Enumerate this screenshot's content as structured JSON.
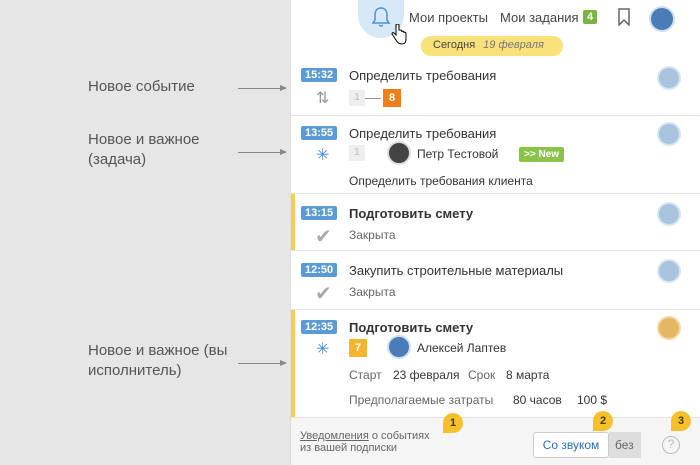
{
  "annotations": [
    {
      "text": "Новое событие"
    },
    {
      "text": "Новое и важное (задача)"
    },
    {
      "text": "Новое и важное (вы исполнитель)"
    }
  ],
  "header": {
    "my_projects": "Мои проекты",
    "my_tasks": "Мои задания",
    "tasks_count": "4",
    "today_label": "Сегодня",
    "today_date": "19 февраля"
  },
  "events": [
    {
      "time": "15:32",
      "title": "Определить требования",
      "gray_num": "1",
      "orange_num": "8",
      "icon": "swap-arrows-icon"
    },
    {
      "time": "13:55",
      "title": "Определить требования",
      "gray_num": "1",
      "person": "Петр Тестовой",
      "badge": ">> New",
      "description": "Определить требования клиента",
      "icon": "snowflake-icon"
    },
    {
      "time": "13:15",
      "title": "Подготовить смету",
      "status": "Закрыта",
      "icon": "checkmark-icon"
    },
    {
      "time": "12:50",
      "title": "Закупить строительные материалы",
      "status": "Закрыта",
      "icon": "checkmark-icon"
    },
    {
      "time": "12:35",
      "title": "Подготовить смету",
      "yellow_num": "7",
      "person": "Алексей Лаптев",
      "start_label": "Старт",
      "start_date": "23 февраля",
      "due_label": "Срок",
      "due_date": "8 марта",
      "cost_label": "Предполагаемые затраты",
      "hours": "80 часов",
      "money": "100 $",
      "icon": "snowflake-icon"
    }
  ],
  "footer": {
    "link": "Уведомления",
    "text1": "о событиях",
    "text2": "из вашей подписки",
    "sound_on": "Со звуком",
    "sound_off": "без",
    "help": "?"
  },
  "bubbles": [
    "1",
    "2",
    "3"
  ],
  "colors": {
    "time_badge": "#5a9bd5",
    "important_stripe": "#f7d04b",
    "today_pill": "#f9e27a",
    "new_badge": "#8bc34a",
    "orange": "#f07f1a"
  }
}
